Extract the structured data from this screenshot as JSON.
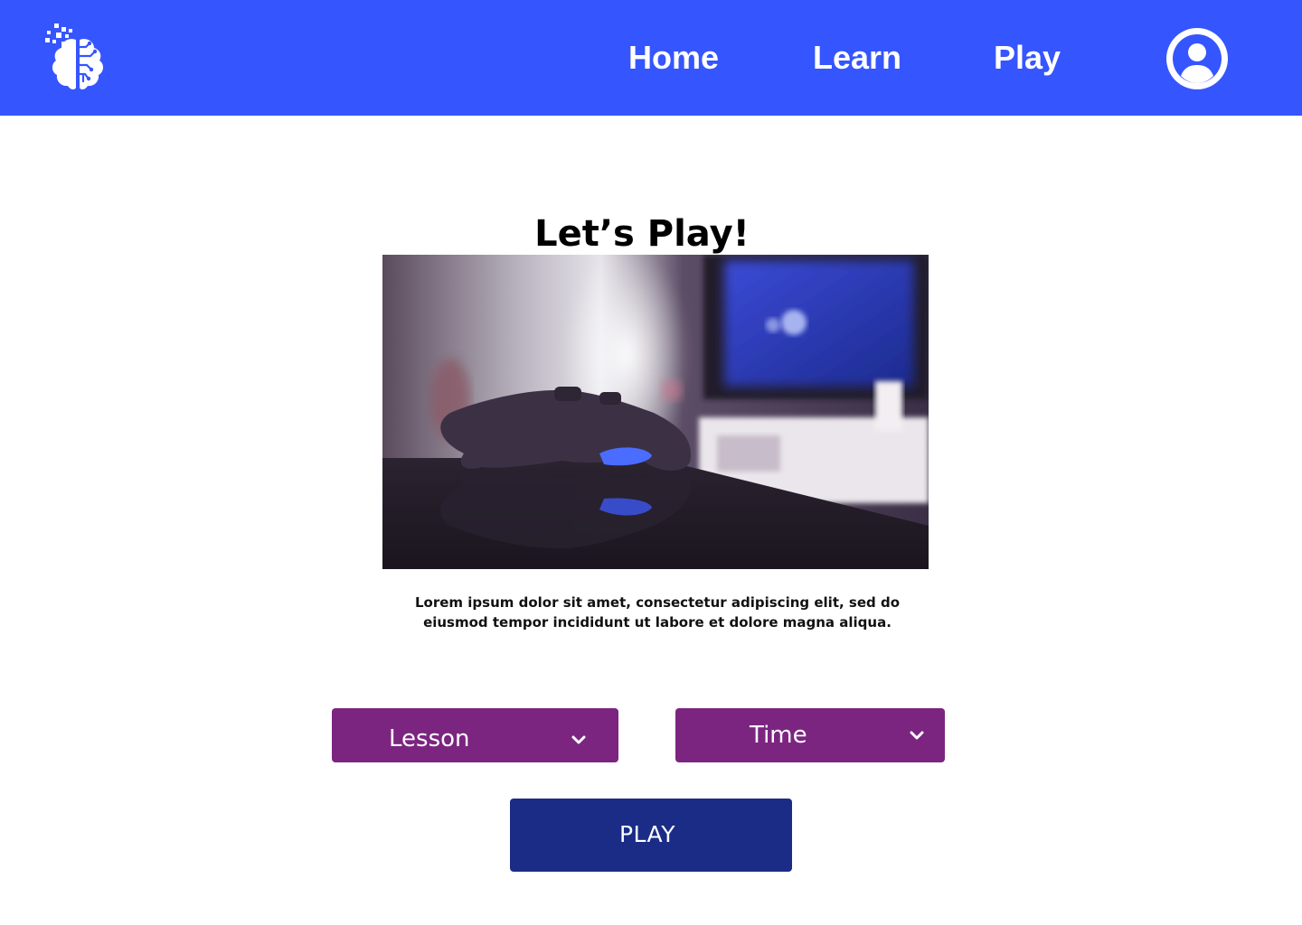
{
  "colors": {
    "nav_background": "#3555FE",
    "dropdown_background": "#7B2580",
    "primary_button": "#1A2C86",
    "text": "#000000",
    "nav_text": "#FFFFFF"
  },
  "header": {
    "logo_icon": "brain-circuit-icon",
    "nav": {
      "home": "Home",
      "learn": "Learn",
      "play": "Play"
    },
    "profile_icon": "user-avatar-icon"
  },
  "main": {
    "title": "Let’s Play!",
    "hero_image": "game-controller-photo",
    "description": "Lorem ipsum dolor sit amet, consectetur adipiscing elit, sed do eiusmod tempor incididunt ut labore et dolore magna aliqua.",
    "dropdowns": {
      "lesson": "Lesson",
      "time": "Time"
    },
    "play_button": "PLAY"
  }
}
